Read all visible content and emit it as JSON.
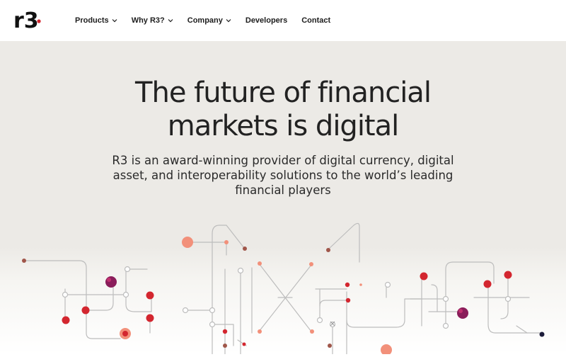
{
  "brand": {
    "logo_text": "r3",
    "accent_color": "#d3262f"
  },
  "nav": {
    "items": [
      {
        "label": "Products",
        "has_dropdown": true
      },
      {
        "label": "Why R3?",
        "has_dropdown": true
      },
      {
        "label": "Company",
        "has_dropdown": true
      },
      {
        "label": "Developers",
        "has_dropdown": false
      },
      {
        "label": "Contact",
        "has_dropdown": false
      }
    ]
  },
  "hero": {
    "title_line1": "The future of financial",
    "title_line2": "markets is digital",
    "subtitle_line1": "R3 is an award-winning provider of digital currency, digital",
    "subtitle_line2": "asset, and interoperability solutions to the world’s leading",
    "subtitle_line3": "financial players",
    "background": "#eceae6"
  },
  "graphic": {
    "icon": "network-circuit-illustration",
    "colors": {
      "line": "#bdbdbd",
      "red": "#d3262f",
      "salmon": "#f2907a",
      "brown": "#a0564a",
      "magenta": "#8a1d5a",
      "navy": "#1c1c3a"
    }
  }
}
